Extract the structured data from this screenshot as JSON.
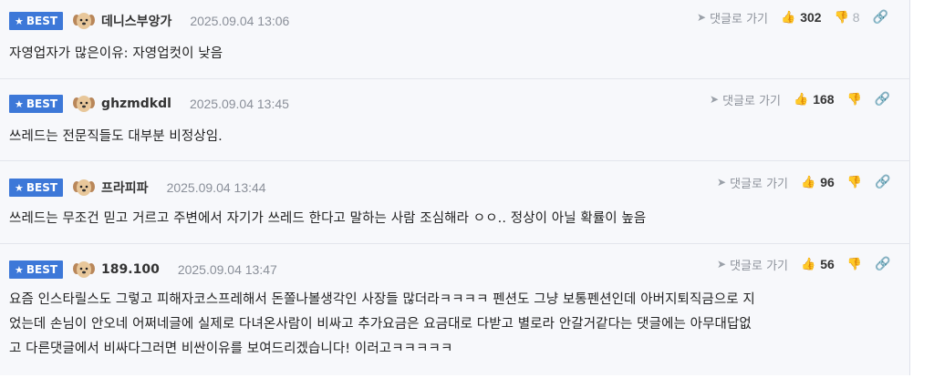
{
  "badge_label": "BEST",
  "reply_label": "댓글로 가기",
  "comments": [
    {
      "nickname": "데니스부앙가",
      "date": "2025.09.04 13:06",
      "likes": "302",
      "dislikes": "8",
      "text": "자영업자가 많은이유: 자영업컷이 낮음"
    },
    {
      "nickname": "ghzmdkdl",
      "date": "2025.09.04 13:45",
      "likes": "168",
      "dislikes": "",
      "text": "쓰레드는 전문직들도 대부분 비정상임."
    },
    {
      "nickname": "프라피파",
      "date": "2025.09.04 13:44",
      "likes": "96",
      "dislikes": "",
      "text": "쓰레드는 무조건 믿고 거르고 주변에서 자기가 쓰레드 한다고 말하는 사람 조심해라 ㅇㅇ.. 정상이 아닐 확률이 높음"
    },
    {
      "nickname": "189.100",
      "date": "2025.09.04 13:47",
      "likes": "56",
      "dislikes": "",
      "text_lines": [
        "요즘 인스타릴스도 그렇고 피해자코스프레해서 돈쫄나볼생각인 사장들 많더라ㅋㅋㅋㅋ 펜션도 그냥 보통펜션인데 아버지퇴직금으로 지",
        "었는데 손님이 안오네 어쩌네글에 실제로 다녀온사람이 비싸고 추가요금은 요금대로 다받고 별로라 안갈거같다는 댓글에는 아무대답없",
        "고 다른댓글에서 비싸다그러면 비싼이유를 보여드리겠습니다! 이러고ㅋㅋㅋㅋㅋ"
      ]
    }
  ]
}
